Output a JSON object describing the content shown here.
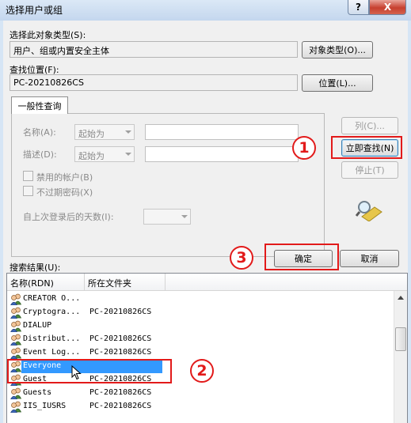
{
  "window": {
    "title": "选择用户或组",
    "help_label": "?",
    "close_label": "X"
  },
  "object_type": {
    "label": "选择此对象类型(S):",
    "value": "用户、组或内置安全主体",
    "button": "对象类型(O)..."
  },
  "location": {
    "label": "查找位置(F):",
    "value": "PC-20210826CS",
    "button": "位置(L)..."
  },
  "query": {
    "tab_label": "一般性查询",
    "name_label": "名称(A):",
    "name_op": "起始为",
    "desc_label": "描述(D):",
    "desc_op": "起始为",
    "disabled_accounts": "禁用的帐户(B)",
    "non_expiring_pw": "不过期密码(X)",
    "days_since_logon": "自上次登录后的天数(I):"
  },
  "buttons": {
    "columns": "列(C)...",
    "find_now": "立即查找(N)",
    "stop": "停止(T)",
    "ok": "确定",
    "cancel": "取消"
  },
  "results": {
    "label": "搜索结果(U):",
    "columns": [
      "名称(RDN)",
      "所在文件夹"
    ],
    "rows": [
      {
        "name": "CREATOR O...",
        "folder": ""
      },
      {
        "name": "Cryptogra...",
        "folder": "PC-20210826CS"
      },
      {
        "name": "DIALUP",
        "folder": ""
      },
      {
        "name": "Distribut...",
        "folder": "PC-20210826CS"
      },
      {
        "name": "Event Log...",
        "folder": "PC-20210826CS"
      },
      {
        "name": "Everyone",
        "folder": "",
        "selected": true
      },
      {
        "name": "Guest",
        "folder": "PC-20210826CS"
      },
      {
        "name": "Guests",
        "folder": "PC-20210826CS"
      },
      {
        "name": "IIS_IUSRS",
        "folder": "PC-20210826CS"
      }
    ]
  },
  "annotations": {
    "step1": "1",
    "step2": "2",
    "step3": "3",
    "highlight_color": "#e21a1a"
  },
  "colors": {
    "selection": "#3399ff",
    "window_frame": "#d6e5f5",
    "close_button": "#c7402f"
  }
}
